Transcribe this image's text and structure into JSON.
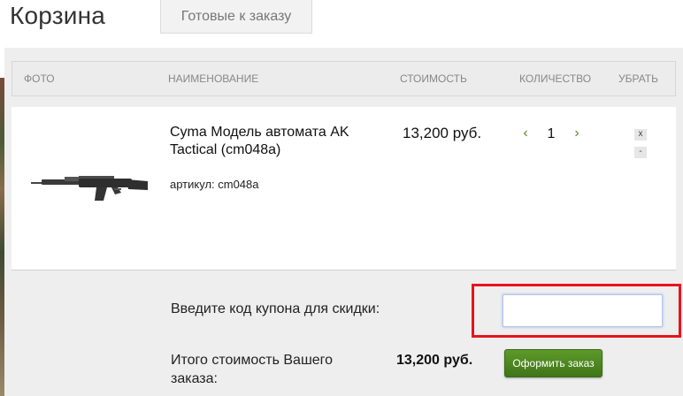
{
  "page": {
    "title": "Корзина",
    "ready_tab": "Готовые к заказу"
  },
  "table": {
    "headers": {
      "photo": "ФОТО",
      "name": "НАИМЕНОВАНИЕ",
      "price": "СТОИМОСТЬ",
      "quantity": "КОЛИЧЕСТВО",
      "remove": "УБРАТЬ"
    },
    "items": [
      {
        "name": "Cyma Модель автомата AK Tactical (cm048a)",
        "sku": "артикул: cm048a",
        "price": "13,200 руб.",
        "quantity": "1",
        "decrease_icon": "chevron-left-icon",
        "increase_icon": "chevron-right-icon",
        "remove_label": "x",
        "minus_label": "-"
      }
    ]
  },
  "coupon": {
    "label": "Введите код купона для скидки:",
    "value": "",
    "placeholder": ""
  },
  "total": {
    "label": "Итого стоимость Вашего заказа:",
    "value": "13,200 руб."
  },
  "checkout": {
    "label": "Оформить заказ"
  },
  "colors": {
    "highlight": "#e8141b",
    "checkout": "#4a8420",
    "panel": "#eeeeee"
  }
}
